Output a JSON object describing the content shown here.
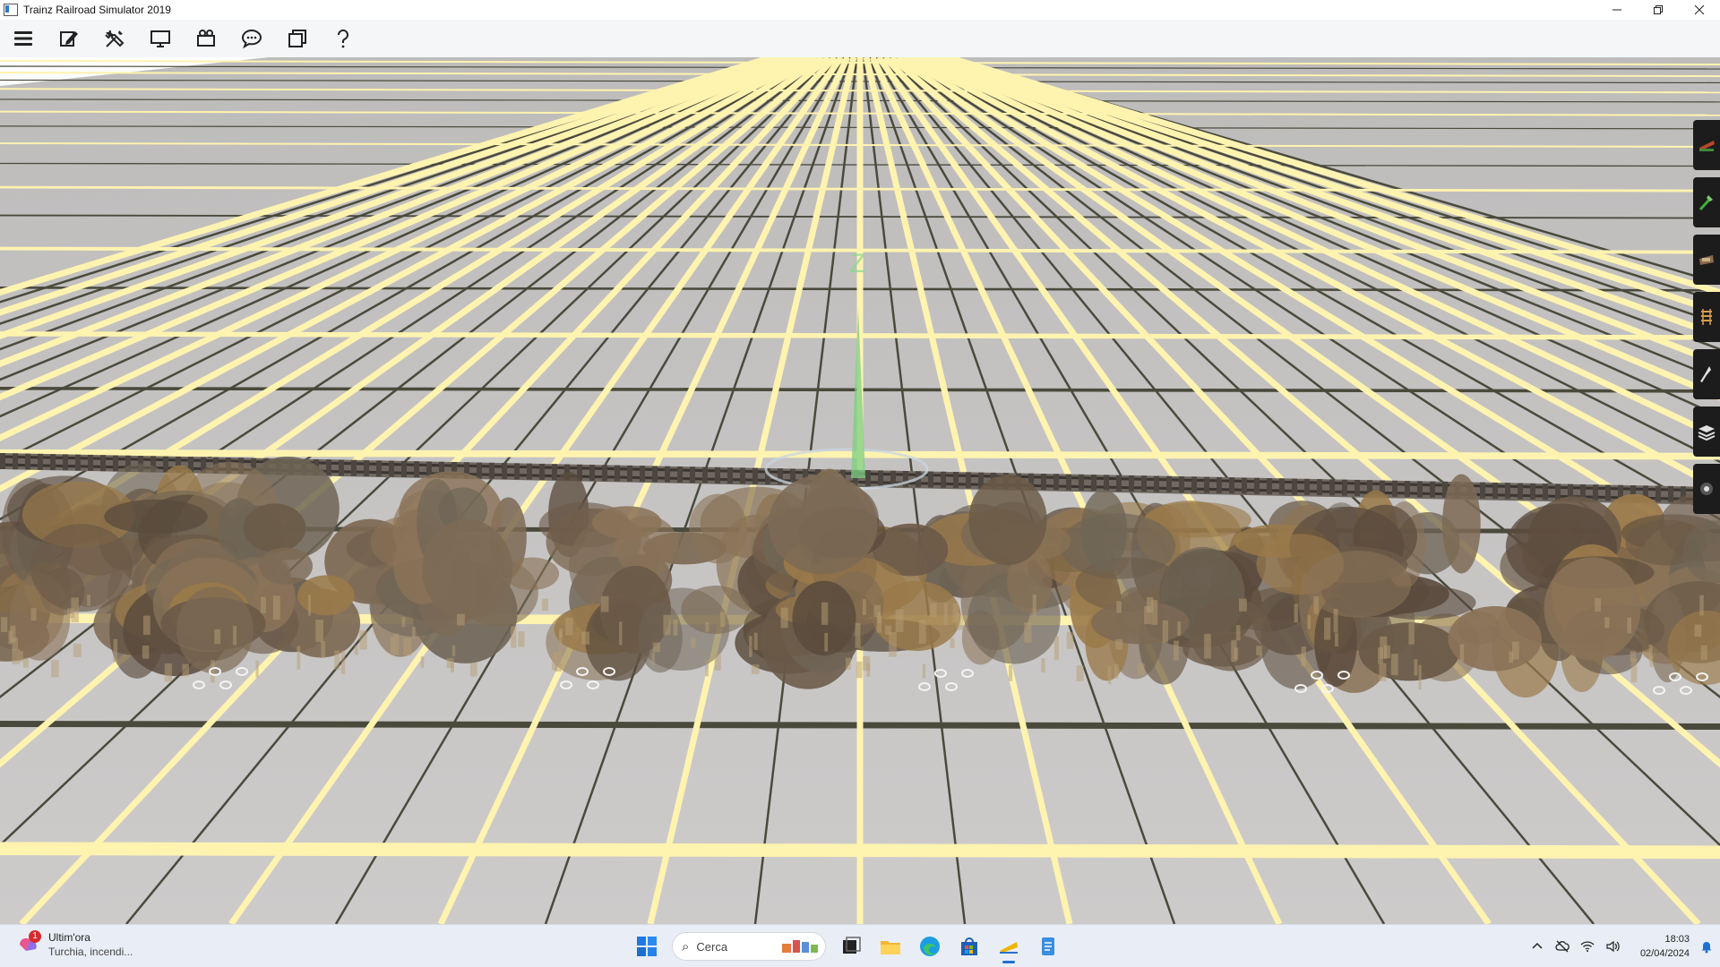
{
  "window": {
    "title": "Trainz Railroad Simulator 2019",
    "minimize_icon": "minimize-icon",
    "maximize_icon": "restore-icon",
    "close_icon": "close-icon"
  },
  "toolbar": {
    "items": [
      {
        "name": "menu-icon"
      },
      {
        "name": "edit-icon"
      },
      {
        "name": "tools-icon"
      },
      {
        "name": "monitor-icon"
      },
      {
        "name": "camera-icon"
      },
      {
        "name": "chat-icon"
      },
      {
        "name": "layers-icon"
      },
      {
        "name": "help-icon"
      }
    ]
  },
  "viewport": {
    "compass_label": "Z",
    "ground_color": "#c9c7c6",
    "grid_major_color": "#fff3b0",
    "grid_minor_color": "#4a4a3c"
  },
  "palette": {
    "tools": [
      {
        "name": "train-tool-icon"
      },
      {
        "name": "terrain-brush-icon"
      },
      {
        "name": "object-tool-icon"
      },
      {
        "name": "track-tool-icon"
      },
      {
        "name": "trackmark-tool-icon"
      },
      {
        "name": "layers-tool-icon"
      },
      {
        "name": "settings-tool-icon"
      }
    ]
  },
  "taskbar": {
    "news_title": "Ultim'ora",
    "news_subtitle": "Turchia, incendi...",
    "news_badge": "1",
    "search_placeholder": "Cerca",
    "apps": [
      {
        "name": "windows-start-icon"
      },
      {
        "name": "task-view-icon"
      },
      {
        "name": "file-explorer-icon"
      },
      {
        "name": "edge-browser-icon"
      },
      {
        "name": "microsoft-store-icon"
      },
      {
        "name": "trainz-app-icon"
      },
      {
        "name": "notepad-icon"
      }
    ],
    "time": "18:03",
    "date": "02/04/2024"
  }
}
